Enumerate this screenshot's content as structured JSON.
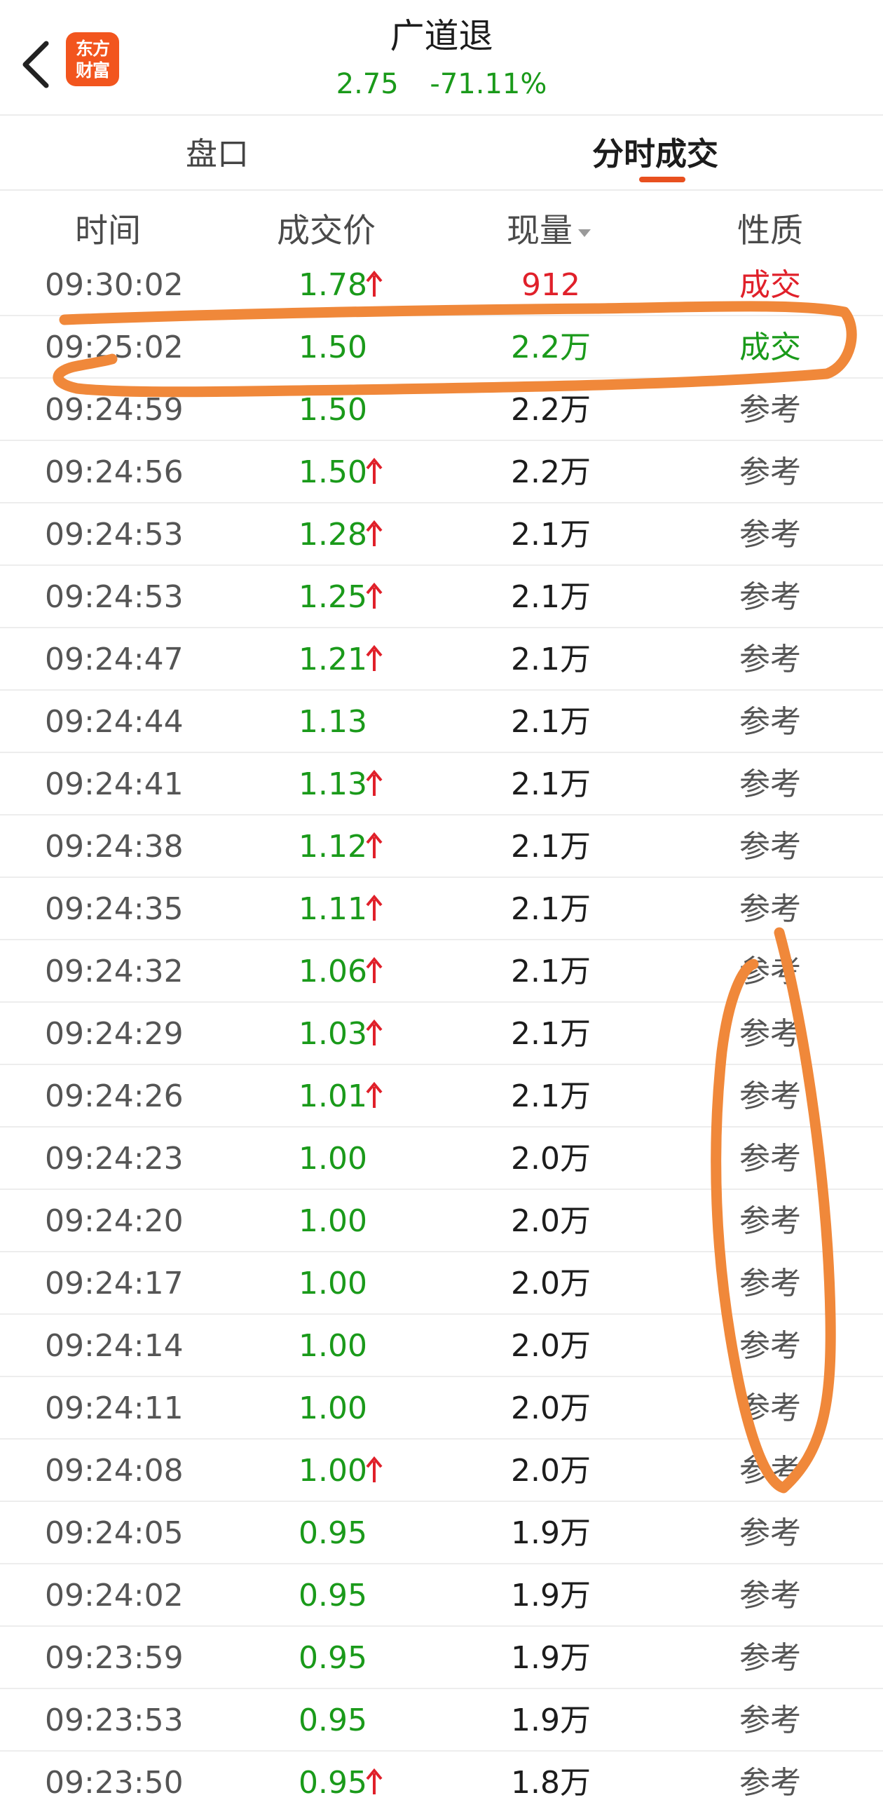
{
  "header": {
    "stock_name": "广道退",
    "price": "2.75",
    "change_pct": "-71.11%",
    "logo_line1": "东方",
    "logo_line2": "财富"
  },
  "tabs": [
    {
      "label": "盘口",
      "active": false
    },
    {
      "label": "分时成交",
      "active": true
    }
  ],
  "columns": {
    "time": "时间",
    "price": "成交价",
    "volume": "现量",
    "nature": "性质"
  },
  "colors": {
    "up": "#e0202a",
    "down": "#1a9a1a",
    "neutral": "#1c1c1c",
    "accent": "#e8501f",
    "annotation": "#f0883a"
  },
  "trades": [
    {
      "time": "09:30:02",
      "price": "1.78",
      "up": true,
      "volume": "912",
      "volume_color": "up",
      "nature": "成交",
      "nature_color": "up"
    },
    {
      "time": "09:25:02",
      "price": "1.50",
      "up": false,
      "volume": "2.2万",
      "volume_color": "down",
      "nature": "成交",
      "nature_color": "down"
    },
    {
      "time": "09:24:59",
      "price": "1.50",
      "up": false,
      "volume": "2.2万",
      "volume_color": "neutral",
      "nature": "参考",
      "nature_color": "ref"
    },
    {
      "time": "09:24:56",
      "price": "1.50",
      "up": true,
      "volume": "2.2万",
      "volume_color": "neutral",
      "nature": "参考",
      "nature_color": "ref"
    },
    {
      "time": "09:24:53",
      "price": "1.28",
      "up": true,
      "volume": "2.1万",
      "volume_color": "neutral",
      "nature": "参考",
      "nature_color": "ref"
    },
    {
      "time": "09:24:53",
      "price": "1.25",
      "up": true,
      "volume": "2.1万",
      "volume_color": "neutral",
      "nature": "参考",
      "nature_color": "ref"
    },
    {
      "time": "09:24:47",
      "price": "1.21",
      "up": true,
      "volume": "2.1万",
      "volume_color": "neutral",
      "nature": "参考",
      "nature_color": "ref"
    },
    {
      "time": "09:24:44",
      "price": "1.13",
      "up": false,
      "volume": "2.1万",
      "volume_color": "neutral",
      "nature": "参考",
      "nature_color": "ref"
    },
    {
      "time": "09:24:41",
      "price": "1.13",
      "up": true,
      "volume": "2.1万",
      "volume_color": "neutral",
      "nature": "参考",
      "nature_color": "ref"
    },
    {
      "time": "09:24:38",
      "price": "1.12",
      "up": true,
      "volume": "2.1万",
      "volume_color": "neutral",
      "nature": "参考",
      "nature_color": "ref"
    },
    {
      "time": "09:24:35",
      "price": "1.11",
      "up": true,
      "volume": "2.1万",
      "volume_color": "neutral",
      "nature": "参考",
      "nature_color": "ref"
    },
    {
      "time": "09:24:32",
      "price": "1.06",
      "up": true,
      "volume": "2.1万",
      "volume_color": "neutral",
      "nature": "参考",
      "nature_color": "ref"
    },
    {
      "time": "09:24:29",
      "price": "1.03",
      "up": true,
      "volume": "2.1万",
      "volume_color": "neutral",
      "nature": "参考",
      "nature_color": "ref"
    },
    {
      "time": "09:24:26",
      "price": "1.01",
      "up": true,
      "volume": "2.1万",
      "volume_color": "neutral",
      "nature": "参考",
      "nature_color": "ref"
    },
    {
      "time": "09:24:23",
      "price": "1.00",
      "up": false,
      "volume": "2.0万",
      "volume_color": "neutral",
      "nature": "参考",
      "nature_color": "ref"
    },
    {
      "time": "09:24:20",
      "price": "1.00",
      "up": false,
      "volume": "2.0万",
      "volume_color": "neutral",
      "nature": "参考",
      "nature_color": "ref"
    },
    {
      "time": "09:24:17",
      "price": "1.00",
      "up": false,
      "volume": "2.0万",
      "volume_color": "neutral",
      "nature": "参考",
      "nature_color": "ref"
    },
    {
      "time": "09:24:14",
      "price": "1.00",
      "up": false,
      "volume": "2.0万",
      "volume_color": "neutral",
      "nature": "参考",
      "nature_color": "ref"
    },
    {
      "time": "09:24:11",
      "price": "1.00",
      "up": false,
      "volume": "2.0万",
      "volume_color": "neutral",
      "nature": "参考",
      "nature_color": "ref"
    },
    {
      "time": "09:24:08",
      "price": "1.00",
      "up": true,
      "volume": "2.0万",
      "volume_color": "neutral",
      "nature": "参考",
      "nature_color": "ref"
    },
    {
      "time": "09:24:05",
      "price": "0.95",
      "up": false,
      "volume": "1.9万",
      "volume_color": "neutral",
      "nature": "参考",
      "nature_color": "ref"
    },
    {
      "time": "09:24:02",
      "price": "0.95",
      "up": false,
      "volume": "1.9万",
      "volume_color": "neutral",
      "nature": "参考",
      "nature_color": "ref"
    },
    {
      "time": "09:23:59",
      "price": "0.95",
      "up": false,
      "volume": "1.9万",
      "volume_color": "neutral",
      "nature": "参考",
      "nature_color": "ref"
    },
    {
      "time": "09:23:53",
      "price": "0.95",
      "up": false,
      "volume": "1.9万",
      "volume_color": "neutral",
      "nature": "参考",
      "nature_color": "ref"
    },
    {
      "time": "09:23:50",
      "price": "0.95",
      "up": true,
      "volume": "1.8万",
      "volume_color": "neutral",
      "nature": "参考",
      "nature_color": "ref"
    }
  ]
}
